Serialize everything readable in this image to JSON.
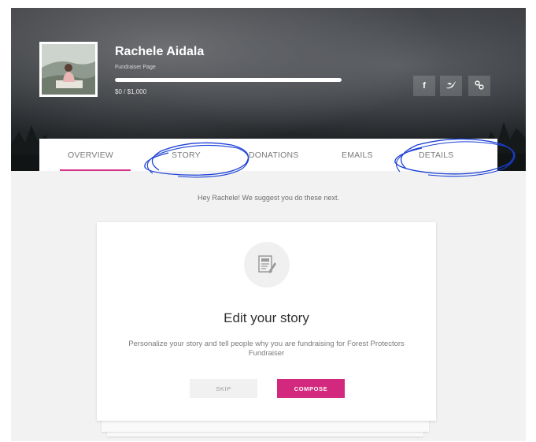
{
  "header": {
    "name": "Rachele Aidala",
    "subtitle": "Fundraiser Page",
    "amount": "$0 / $1,000",
    "progress_fraction": 1.0
  },
  "social": {
    "facebook_glyph": "f",
    "twitter_glyph": "✔",
    "link_glyph": "%"
  },
  "tabs": [
    {
      "label": "OVERVIEW",
      "active": true
    },
    {
      "label": "STORY",
      "active": false
    },
    {
      "label": "DONATIONS",
      "active": false
    },
    {
      "label": "EMAILS",
      "active": false
    },
    {
      "label": "DETAILS",
      "active": false
    }
  ],
  "hint": "Hey Rachele! We suggest you do these next.",
  "card": {
    "title": "Edit your story",
    "description": "Personalize your story and tell people why you are fundraising for Forest Protectors Fundraiser",
    "skip_label": "SKIP",
    "compose_label": "COMPOSE"
  },
  "colors": {
    "accent": "#d2297f",
    "annotation": "#1a3fd6"
  },
  "icons": [
    "facebook-icon",
    "twitter-icon",
    "link-icon",
    "edit-story-icon"
  ]
}
